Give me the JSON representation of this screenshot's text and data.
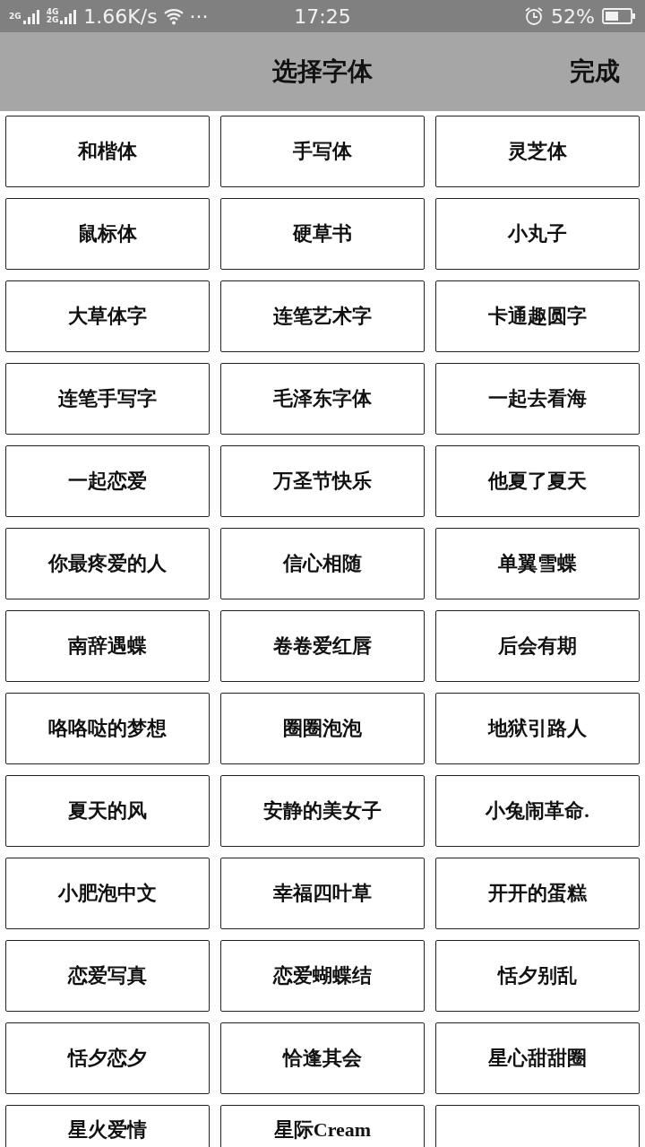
{
  "status_bar": {
    "network_speed": "1.66K/s",
    "more": "···",
    "time": "17:25",
    "battery": "52%",
    "signal_labels": [
      "2G",
      "4G",
      "2G"
    ]
  },
  "header": {
    "title": "选择字体",
    "done": "完成"
  },
  "fonts": [
    {
      "label": "和楷体"
    },
    {
      "label": "手写体"
    },
    {
      "label": "灵芝体"
    },
    {
      "label": "鼠标体"
    },
    {
      "label": "硬草书"
    },
    {
      "label": "小丸子"
    },
    {
      "label": "大草体字"
    },
    {
      "label": "连笔艺术字"
    },
    {
      "label": "卡通趣圆字"
    },
    {
      "label": "连笔手写字"
    },
    {
      "label": "毛泽东字体"
    },
    {
      "label": "一起去看海"
    },
    {
      "label": "一起恋爱"
    },
    {
      "label": "万圣节快乐"
    },
    {
      "label": "他夏了夏天"
    },
    {
      "label": "你最疼爱的人"
    },
    {
      "label": "信心相随"
    },
    {
      "label": "单翼雪蝶"
    },
    {
      "label": "南辞遇蝶"
    },
    {
      "label": "卷卷爱红唇"
    },
    {
      "label": "后会有期"
    },
    {
      "label": "咯咯哒的梦想"
    },
    {
      "label": "圈圈泡泡"
    },
    {
      "label": "地狱引路人"
    },
    {
      "label": "夏天的风"
    },
    {
      "label": "安静的美女子"
    },
    {
      "label": "小兔闹革命."
    },
    {
      "label": "小肥泡中文"
    },
    {
      "label": "幸福四叶草"
    },
    {
      "label": "开开的蛋糕"
    },
    {
      "label": "恋爱写真"
    },
    {
      "label": "恋爱蝴蝶结"
    },
    {
      "label": "恬夕别乱"
    },
    {
      "label": "恬夕恋夕"
    },
    {
      "label": "恰逢其会"
    },
    {
      "label": "星心甜甜圈"
    },
    {
      "label": "星火爱情"
    },
    {
      "label": "星际Cream"
    }
  ]
}
